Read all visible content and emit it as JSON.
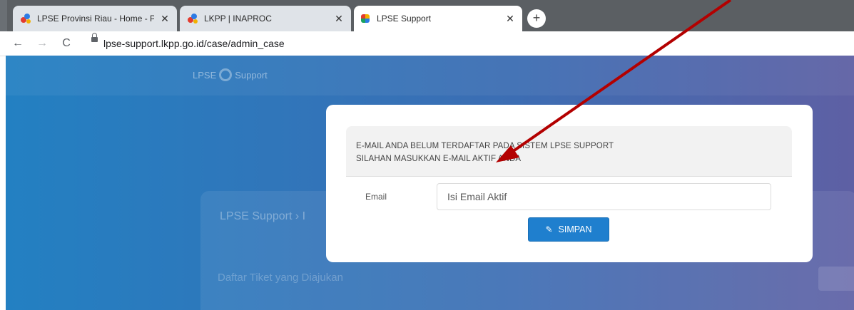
{
  "browser": {
    "tabs": [
      {
        "title": "LPSE Provinsi Riau - Home - Peny",
        "close": "✕"
      },
      {
        "title": "LKPP | INAPROC",
        "close": "✕"
      },
      {
        "title": "LPSE Support",
        "close": "✕"
      }
    ],
    "new_tab": "+",
    "url": "lpse-support.lkpp.go.id/case/admin_case"
  },
  "site": {
    "logo_left": "LPSE",
    "logo_right": "Support",
    "breadcrumb": "LPSE Support  ›  I",
    "tickets_heading": "Daftar Tiket yang Diajukan"
  },
  "modal": {
    "notice_line1": "E-MAIL ANDA BELUM TERDAFTAR PADA SISTEM LPSE SUPPORT",
    "notice_line2": "SILAHAN MASUKKAN E-MAIL AKTIF ANDA",
    "email_label": "Email",
    "email_placeholder": "Isi Email Aktif",
    "save_label": "SIMPAN"
  },
  "colors": {
    "arrow": "#b30000",
    "button": "#1f7fce"
  }
}
